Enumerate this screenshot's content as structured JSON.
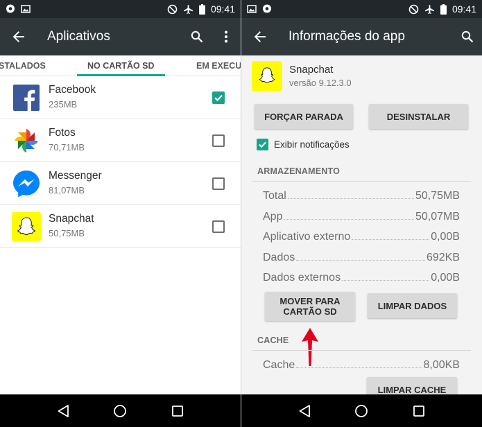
{
  "status": {
    "time": "09:41"
  },
  "left": {
    "title": "Aplicativos",
    "tabs": [
      "STALADOS",
      "NO CARTÃO SD",
      "EM EXECU"
    ],
    "apps": [
      {
        "name": "Facebook",
        "size": "235MB",
        "checked": true
      },
      {
        "name": "Fotos",
        "size": "70,71MB",
        "checked": false
      },
      {
        "name": "Messenger",
        "size": "81,07MB",
        "checked": false
      },
      {
        "name": "Snapchat",
        "size": "50,75MB",
        "checked": false
      }
    ]
  },
  "right": {
    "title": "Informações do app",
    "app_name": "Snapchat",
    "app_version": "versão 9.12.3.0",
    "force_stop": "FORÇAR PARADA",
    "uninstall": "DESINSTALAR",
    "show_notifications": "Exibir notificações",
    "storage_header": "ARMAZENAMENTO",
    "storage_rows": [
      {
        "label": "Total",
        "value": "50,75MB"
      },
      {
        "label": "App",
        "value": "50,07MB"
      },
      {
        "label": "Aplicativo externo",
        "value": "0,00B"
      },
      {
        "label": "Dados",
        "value": "692KB"
      },
      {
        "label": "Dados externos",
        "value": "0,00B"
      }
    ],
    "move_line1": "MOVER PARA",
    "move_line2": "CARTÃO SD",
    "clear_data": "LIMPAR DADOS",
    "cache_header": "CACHE",
    "cache_label": "Cache",
    "cache_value": "8,00KB",
    "clear_cache": "LIMPAR CACHE"
  },
  "colors": {
    "accent": "#1aa38b",
    "appbar": "#2f373b",
    "statusbar": "#21272b",
    "arrow": "#e3001b",
    "snapchat_yellow": "#fffc00"
  },
  "icons": {
    "status_left": [
      "chat-bubble-icon",
      "image-icon"
    ],
    "status_right": [
      "do-not-disturb-icon",
      "airplane-icon",
      "battery-icon"
    ],
    "nav": [
      "back-triangle-icon",
      "home-circle-icon",
      "recents-square-icon"
    ]
  }
}
